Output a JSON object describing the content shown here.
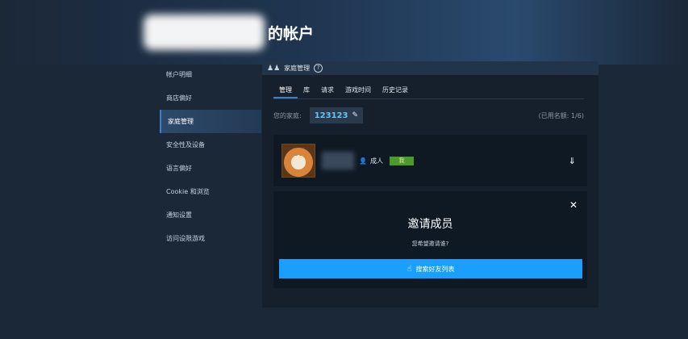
{
  "header": {
    "title": "的帐户"
  },
  "sidebar": {
    "items": [
      {
        "label": "帐户明细"
      },
      {
        "label": "商店偏好"
      },
      {
        "label": "家庭管理"
      },
      {
        "label": "安全性及设备"
      },
      {
        "label": "语言偏好"
      },
      {
        "label": "Cookie 和浏览"
      },
      {
        "label": "通知设置"
      },
      {
        "label": "访问设限游戏"
      }
    ],
    "active_index": 2
  },
  "panel": {
    "title": "家庭管理",
    "help": "?",
    "tabs": [
      {
        "label": "管理"
      },
      {
        "label": "库"
      },
      {
        "label": "请求"
      },
      {
        "label": "游戏时间"
      },
      {
        "label": "历史记录"
      }
    ],
    "active_tab": 0,
    "family_label": "您的家庭:",
    "family_name": "123123",
    "slots_text": "(已用名额: 1/6)",
    "member": {
      "role": "成人",
      "badge": "我"
    },
    "invite": {
      "title": "邀请成员",
      "question": "您希望邀请谁?",
      "button_label": "搜索好友列表"
    }
  },
  "icons": {
    "family": "family-icon",
    "help": "help-icon",
    "edit": "pencil-icon",
    "user": "user-icon",
    "expand": "double-chevron-down-icon",
    "close": "close-icon",
    "cursor": "hand-cursor-icon"
  },
  "colors": {
    "background": "#1b2838",
    "panel": "#16202d",
    "accent": "#1a9fff",
    "badge": "#4c9a2a",
    "family_name": "#67c1f5"
  }
}
